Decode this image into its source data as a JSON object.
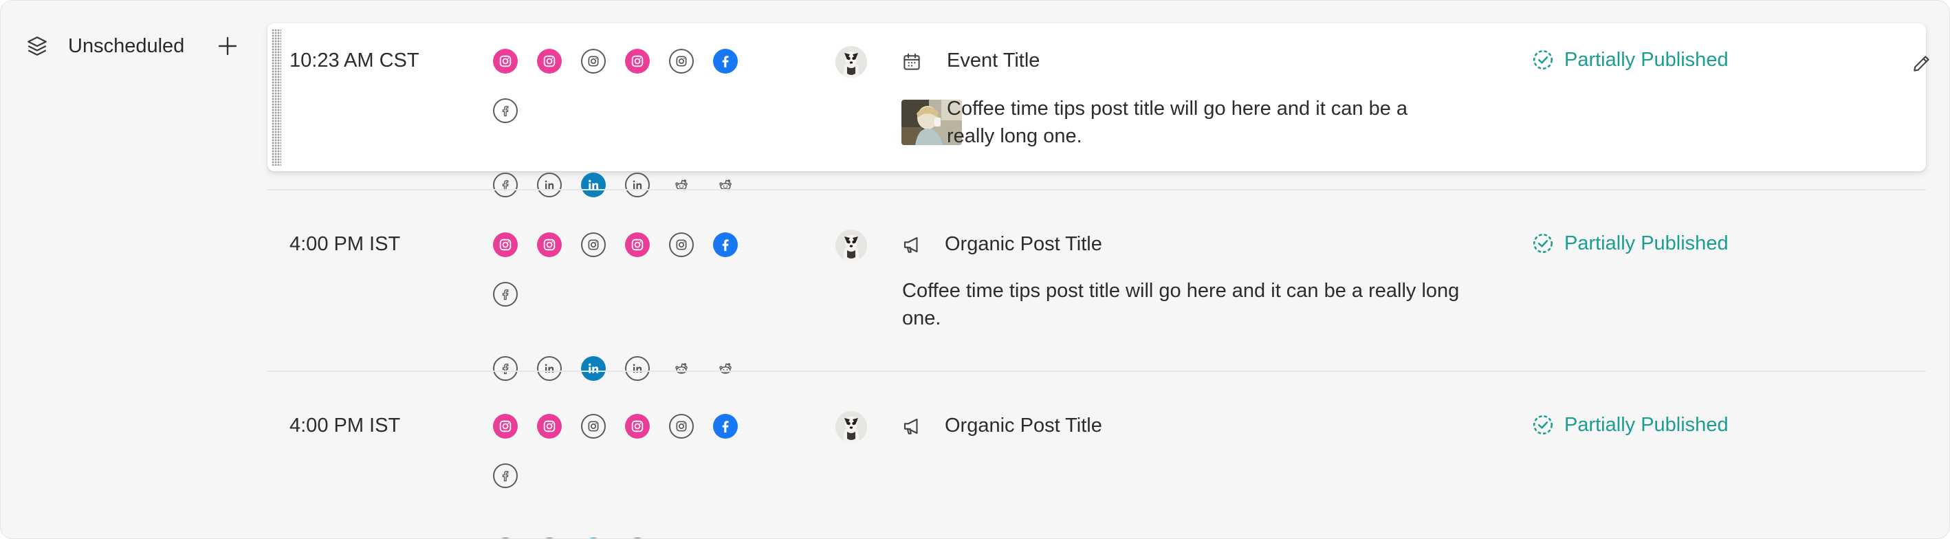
{
  "sidebar": {
    "label": "Unscheduled",
    "icon": "layers-icon",
    "add_icon": "plus-icon"
  },
  "colors": {
    "status": "#1a9e91",
    "instagram": "#e93d98",
    "facebook": "#1877f2",
    "linkedin": "#0a80bd",
    "active_row_bg": "#ffffff",
    "list_bg": "#f6f6f6"
  },
  "rows": [
    {
      "time": "10:23 AM CST",
      "post_type": "event",
      "type_icon": "calendar-icon",
      "title": "Event Title",
      "description": "Coffee time tips post title will go here and it can be a really long one.",
      "description_lines": [
        "Coffee time tips post title will go here and it can be a",
        "really long one."
      ],
      "has_thumbnail": true,
      "status": "Partially Published",
      "actions": [
        "edit-icon",
        "layers-add-icon",
        "trash-icon"
      ],
      "channels": [
        "instagram-filled",
        "instagram-filled",
        "instagram-outline",
        "instagram-filled",
        "instagram-outline",
        "facebook-filled",
        "facebook-outline",
        "facebook-outline",
        "linkedin-outline",
        "linkedin-filled",
        "linkedin-outline",
        "reddit-outline",
        "reddit-outline"
      ]
    },
    {
      "time": "4:00 PM IST",
      "post_type": "organic",
      "type_icon": "megaphone-icon",
      "title": "Organic Post Title",
      "description": "Coffee time tips post title will go here and it can be a really long one.",
      "description_lines": [
        "Coffee time tips post title will go here and it can be a really long",
        "one."
      ],
      "has_thumbnail": false,
      "status": "Partially Published",
      "channels": [
        "instagram-filled",
        "instagram-filled",
        "instagram-outline",
        "instagram-filled",
        "instagram-outline",
        "facebook-filled",
        "facebook-outline",
        "facebook-outline",
        "linkedin-outline",
        "linkedin-filled",
        "linkedin-outline",
        "reddit-outline",
        "reddit-outline"
      ]
    },
    {
      "time": "4:00 PM IST",
      "post_type": "organic",
      "type_icon": "megaphone-icon",
      "title": "Organic Post Title",
      "has_thumbnail": false,
      "status": "Partially Published",
      "channels": [
        "instagram-filled",
        "instagram-filled",
        "instagram-outline",
        "instagram-filled",
        "instagram-outline",
        "facebook-filled",
        "facebook-outline",
        "facebook-outline",
        "linkedin-outline",
        "linkedin-filled",
        "linkedin-outline",
        "reddit-outline",
        "reddit-outline"
      ]
    }
  ]
}
